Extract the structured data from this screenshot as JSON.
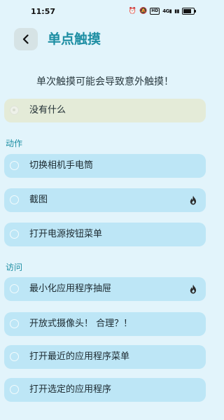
{
  "status_bar": {
    "time": "11:57",
    "signal_text": "4G",
    "icons": [
      "alarm-icon",
      "mute-icon",
      "hd-icon",
      "signal-icon",
      "signal-icon",
      "battery-icon"
    ]
  },
  "header": {
    "title": "单点触摸",
    "back_icon": "chevron-left-icon"
  },
  "warning": "单次触摸可能会导致意外触摸！",
  "none_option": {
    "label": "没有什么",
    "selected": true
  },
  "sections": {
    "actions": {
      "title": "动作",
      "items": [
        {
          "label": "切换相机手电筒",
          "has_flame": false
        },
        {
          "label": "截图",
          "has_flame": true
        },
        {
          "label": "打开电源按钮菜单",
          "has_flame": false
        }
      ]
    },
    "access": {
      "title": "访问",
      "items": [
        {
          "label": "最小化应用程序抽屉",
          "has_flame": true
        },
        {
          "label": "开放式摄像头！ 合理？！",
          "has_flame": false
        },
        {
          "label": "打开最近的应用程序菜单",
          "has_flame": false
        },
        {
          "label": "打开选定的应用程序",
          "has_flame": false
        }
      ]
    }
  },
  "colors": {
    "background": "#e2f4fb",
    "accent": "#1d8ea3",
    "row": "#bde6f6",
    "selected_row": "#e4ebd8"
  }
}
